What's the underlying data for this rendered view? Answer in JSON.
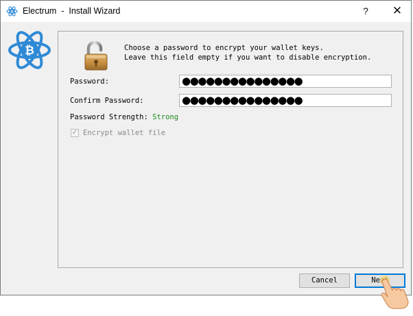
{
  "window": {
    "title": "Electrum  -  Install Wizard",
    "help_label": "?",
    "close_label": "✕"
  },
  "instructions": {
    "line1": "Choose a password to encrypt your wallet keys.",
    "line2": "Leave this field empty if you want to disable encryption."
  },
  "form": {
    "password_label": "Password:",
    "password_value": "●●●●●●●●●●●●●●●",
    "confirm_label": "Confirm Password:",
    "confirm_value": "●●●●●●●●●●●●●●●",
    "strength_label": "Password Strength:",
    "strength_value": "Strong",
    "encrypt_label": "Encrypt wallet file",
    "encrypt_checked": true
  },
  "buttons": {
    "cancel": "Cancel",
    "next": "Next"
  },
  "icons": {
    "app": "electrum-logo-icon",
    "lock": "unlocked-padlock-icon",
    "pointer": "hand-pointer-icon"
  },
  "colors": {
    "brand_blue": "#2f8ad6",
    "strength_strong": "#1d8b1d",
    "focus_border": "#0078d7"
  }
}
